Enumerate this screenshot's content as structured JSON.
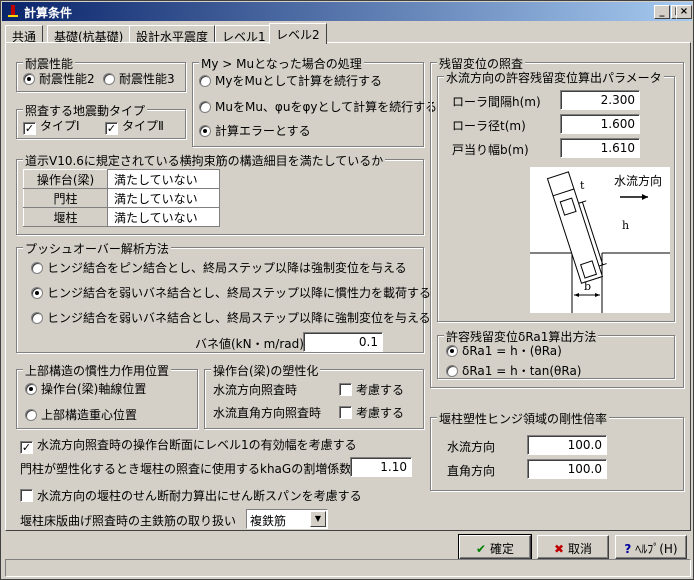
{
  "window": {
    "title": "計算条件"
  },
  "tabs": [
    "共通",
    "基礎(杭基礎)",
    "設計水平震度",
    "レベル1",
    "レベル2"
  ],
  "seismic_perf": {
    "title": "耐震性能",
    "opt1": "耐震性能2",
    "opt2": "耐震性能3"
  },
  "ground_motion": {
    "title": "照査する地震動タイプ",
    "opt1": "タイプⅠ",
    "opt2": "タイプⅡ"
  },
  "my_mu": {
    "title": "My > Muとなった場合の処理",
    "opt1": "MyをMuとして計算を続行する",
    "opt2": "MuをMu、φuをφyとして計算を続行する",
    "opt3": "計算エラーとする"
  },
  "restraint": {
    "title": "道示V10.6に規定されている横拘束筋の構造細目を満たしているか",
    "rows": [
      {
        "label": "操作台(梁)",
        "value": "満たしていない"
      },
      {
        "label": "門柱",
        "value": "満たしていない"
      },
      {
        "label": "堰柱",
        "value": "満たしていない"
      }
    ]
  },
  "pushover": {
    "title": "プッシュオーバー解析方法",
    "opt1": "ヒンジ結合をピン結合とし、終局ステップ以降は強制変位を与える",
    "opt2": "ヒンジ結合を弱いバネ結合とし、終局ステップ以降に慣性力を載荷する",
    "opt3": "ヒンジ結合を弱いバネ結合とし、終局ステップ以降に強制変位を与える",
    "spring_label": "バネ値(kN・m/rad)",
    "spring_value": "0.1"
  },
  "inertia_pos": {
    "title": "上部構造の慣性力作用位置",
    "opt1": "操作台(梁)軸線位置",
    "opt2": "上部構造重心位置"
  },
  "plasticity": {
    "title": "操作台(梁)の塑性化",
    "row1": "水流方向照査時",
    "row2": "水流直角方向照査時",
    "chk_label": "考慮する"
  },
  "options": {
    "level1_stiffness": "水流方向照査時の操作台断面にレベル1の有効幅を考慮する",
    "khag_label": "門柱が塑性化するとき堰柱の照査に使用するkhaGの割増係数",
    "khag_value": "1.10",
    "shear_span": "水流方向の堰柱のせん断耐力算出にせん断スパンを考慮する",
    "rebar_label": "堰柱床版曲げ照査時の主鉄筋の取り扱い",
    "rebar_value": "複鉄筋"
  },
  "residual": {
    "title": "残留変位の照査",
    "param_title": "水流方向の許容残留変位算出パラメータ",
    "roller_gap_label": "ローラ間隔h(m)",
    "roller_gap": "2.300",
    "roller_dia_label": "ローラ径t(m)",
    "roller_dia": "1.600",
    "stop_width_label": "戸当り幅b(m)",
    "stop_width": "1.610",
    "diagram_label": "水流方向",
    "diagram_t": "t",
    "diagram_h": "h",
    "diagram_b": "b",
    "method_title": "許容残留変位δRa1算出方法",
    "method1": "δRa1 = h・(θRa)",
    "method2": "δRa1 = h・tan(θRa)"
  },
  "hinge_stiffness": {
    "title": "堰柱塑性ヒンジ領域の剛性倍率",
    "flow_label": "水流方向",
    "flow_value": "100.0",
    "perp_label": "直角方向",
    "perp_value": "100.0"
  },
  "buttons": {
    "ok": "確定",
    "cancel": "取消",
    "help": "ﾍﾙﾌﾟ(H)"
  }
}
